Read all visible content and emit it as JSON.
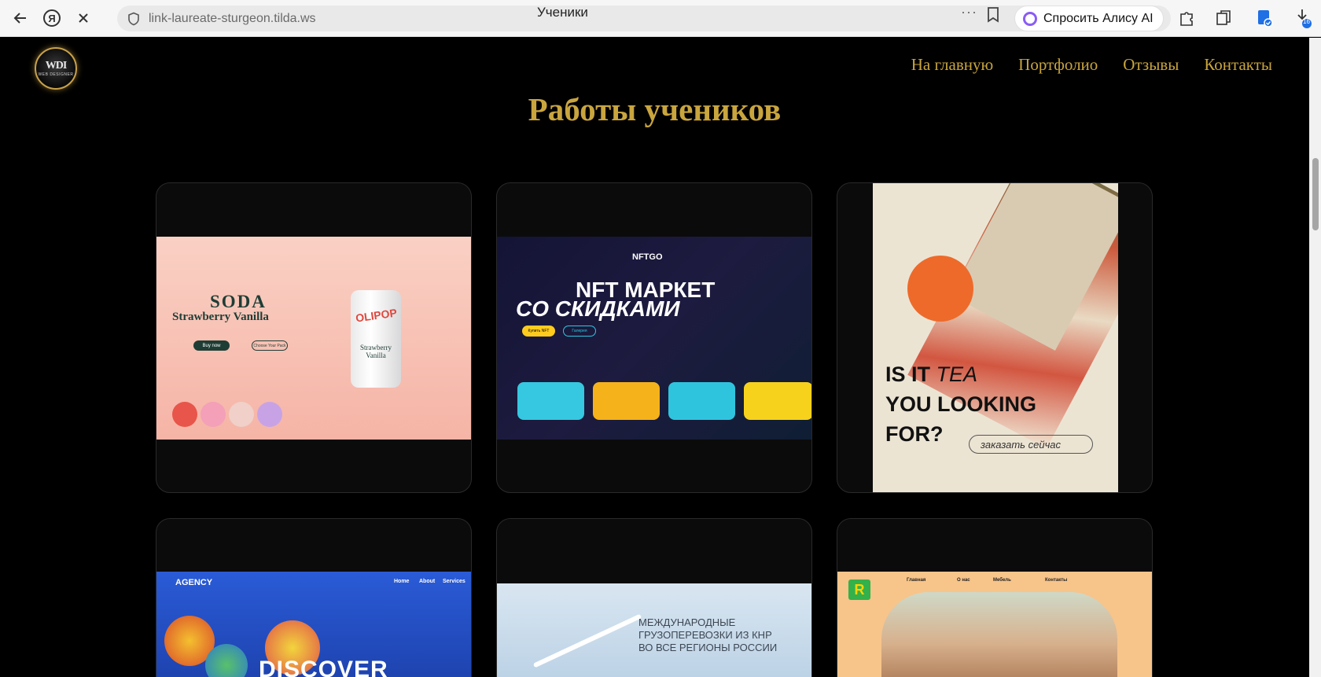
{
  "browser": {
    "url": "link-laureate-sturgeon.tilda.ws",
    "tab_title": "Ученики",
    "alice_label": "Спросить Алису AI",
    "download_count": "16"
  },
  "site": {
    "logo_mark": "WDI",
    "logo_sub": "WEB DESIGNER",
    "nav": [
      "На главную",
      "Портфолио",
      "Отзывы",
      "Контакты"
    ],
    "heading": "Работы учеников"
  },
  "works": {
    "soda": {
      "title": "SODA",
      "subtitle": "Strawberry Vanilla",
      "buy": "Buy now",
      "choose": "Choose Your Pack",
      "can_brand": "OLIPOP",
      "can_flavor": "Strawberry Vanilla"
    },
    "nft": {
      "logo": "NFTGO",
      "line1": "NFT МАРКЕТ",
      "line2": "СО СКИДКАМИ",
      "buy": "Купить NFT",
      "gallery": "Галерея"
    },
    "tea": {
      "q1": "IS IT",
      "q1_italic": "TEA",
      "q2": "YOU LOOKING",
      "q3": "FOR?",
      "order": "заказать сейчас"
    },
    "agency": {
      "label": "AGENCY",
      "nav": [
        "Home",
        "About",
        "Services"
      ],
      "hero": "DISCOVER"
    },
    "cargo": {
      "line1": "МЕЖДУНАРОДНЫЕ",
      "line2": "ГРУЗОПЕРЕВОЗКИ ИЗ КНР",
      "line3": "ВО ВСЕ РЕГИОНЫ РОССИИ"
    },
    "furniture": {
      "logo": "R",
      "nav": [
        "Главная",
        "О нас",
        "Мебель",
        "Контакты"
      ]
    }
  }
}
